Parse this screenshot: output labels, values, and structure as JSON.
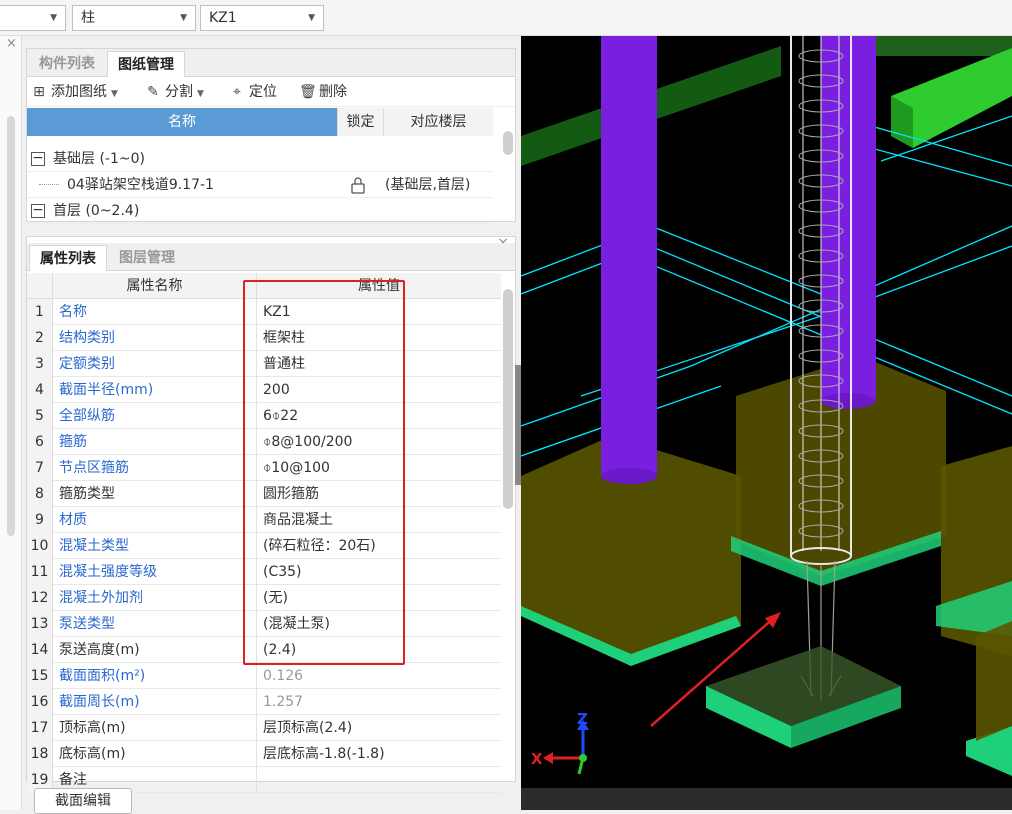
{
  "topbar": {
    "combo1": {
      "value": ""
    },
    "combo2": {
      "value": "柱"
    },
    "combo3": {
      "value": "KZ1"
    }
  },
  "drawing_panel": {
    "tabs": [
      "构件列表",
      "图纸管理"
    ],
    "active_tab": "图纸管理",
    "toolbar": {
      "add": "添加图纸",
      "split": "分割",
      "locate": "定位",
      "delete": "删除"
    },
    "columns": {
      "name": "名称",
      "lock": "锁定",
      "floor": "对应楼层"
    },
    "rows": [
      {
        "toggle": "−",
        "name": "基础层 (-1~0)"
      },
      {
        "name": "04驿站架空栈道9.17-1",
        "floor": "(基础层,首层)"
      },
      {
        "toggle": "−",
        "name": "首层 (0~2.4)"
      }
    ]
  },
  "props_panel": {
    "tabs": [
      "属性列表",
      "图层管理"
    ],
    "active_tab": "属性列表",
    "columns": {
      "name": "属性名称",
      "value": "属性值"
    },
    "rows": [
      {
        "n": "1",
        "name": "名称",
        "value": "KZ1",
        "name_color": "blue",
        "value_color": "dark"
      },
      {
        "n": "2",
        "name": "结构类别",
        "value": "框架柱",
        "name_color": "blue",
        "value_color": "dark"
      },
      {
        "n": "3",
        "name": "定额类别",
        "value": "普通柱",
        "name_color": "blue",
        "value_color": "dark"
      },
      {
        "n": "4",
        "name": "截面半径(mm)",
        "value": "200",
        "name_color": "blue",
        "value_color": "dark"
      },
      {
        "n": "5",
        "name": "全部纵筋",
        "value": "6⌽22",
        "name_color": "blue",
        "value_color": "dark"
      },
      {
        "n": "6",
        "name": "箍筋",
        "value": "⌽8@100/200",
        "name_color": "blue",
        "value_color": "dark"
      },
      {
        "n": "7",
        "name": "节点区箍筋",
        "value": "⌽10@100",
        "name_color": "blue",
        "value_color": "dark"
      },
      {
        "n": "8",
        "name": "箍筋类型",
        "value": "圆形箍筋",
        "name_color": "dark",
        "value_color": "dark"
      },
      {
        "n": "9",
        "name": "材质",
        "value": "商品混凝土",
        "name_color": "blue",
        "value_color": "dark"
      },
      {
        "n": "10",
        "name": "混凝土类型",
        "value": "(碎石粒径：20石)",
        "name_color": "blue",
        "value_color": "dark"
      },
      {
        "n": "11",
        "name": "混凝土强度等级",
        "value": "(C35)",
        "name_color": "blue",
        "value_color": "dark"
      },
      {
        "n": "12",
        "name": "混凝土外加剂",
        "value": "(无)",
        "name_color": "blue",
        "value_color": "dark"
      },
      {
        "n": "13",
        "name": "泵送类型",
        "value": "(混凝土泵)",
        "name_color": "blue",
        "value_color": "dark"
      },
      {
        "n": "14",
        "name": "泵送高度(m)",
        "value": "(2.4)",
        "name_color": "dark",
        "value_color": "dark"
      },
      {
        "n": "15",
        "name": "截面面积(m²)",
        "value": "0.126",
        "name_color": "blue",
        "value_color": "grey"
      },
      {
        "n": "16",
        "name": "截面周长(m)",
        "value": "1.257",
        "name_color": "blue",
        "value_color": "grey"
      },
      {
        "n": "17",
        "name": "顶标高(m)",
        "value": "层顶标高(2.4)",
        "name_color": "dark",
        "value_color": "dark"
      },
      {
        "n": "18",
        "name": "底标高(m)",
        "value": "层底标高-1.8(-1.8)",
        "name_color": "dark",
        "value_color": "dark"
      },
      {
        "n": "19",
        "name": "备注",
        "value": "",
        "name_color": "dark",
        "value_color": "dark"
      }
    ]
  },
  "bottom_button": "截面编辑",
  "viewport": {
    "axis_z": "Z",
    "axis_x": "X",
    "colors": {
      "column": "#7a1fe0",
      "footing": "#5a5500",
      "pad": "#1fd07a",
      "beam": "#2ecc2e",
      "grid": "#00e5ff",
      "arrow": "#e02020"
    }
  }
}
